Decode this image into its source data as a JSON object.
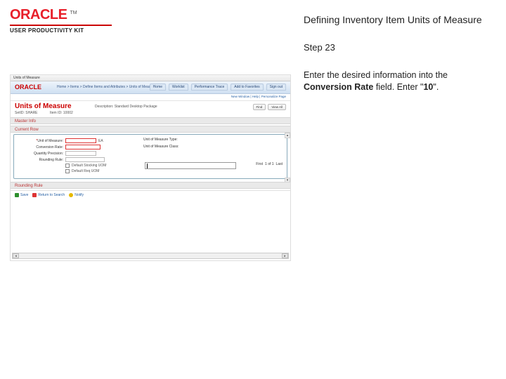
{
  "brand": {
    "oracle_word": "ORACLE",
    "tm": "TM",
    "upk_label": "USER PRODUCTIVITY KIT"
  },
  "topic_title": "Defining Inventory Item Units of Measure",
  "step_label": "Step 23",
  "instruction": {
    "pre": "Enter the desired information into the ",
    "bold1": "Conversion Rate",
    "mid": " field. Enter \"",
    "bold2": "10",
    "post": "\"."
  },
  "mini": {
    "titlebar": "Units of Measure",
    "crumbs": "Home > Items > Define Items and Attributes > Units of Measure",
    "tabs": [
      "Home",
      "Worklist",
      "Performance Trace",
      "Add to Favorites",
      "Sign out"
    ],
    "sublinks": "New Window | Help | Personalize Page",
    "page_h1": "Units of Measure",
    "meta_setid": "SetID: SHARE",
    "meta_itemid": "Item ID: 10002",
    "meta_desc": "Description: Standard Desktop Package",
    "actions": [
      "Find",
      "View All"
    ],
    "section_master": "Master Info",
    "section_current": "Current Row",
    "fields": {
      "uom": {
        "label": "Unit of Measure:",
        "req": true,
        "value": "EA"
      },
      "qty": {
        "label": "Quantity Precision:",
        "value": ""
      },
      "convrate_left": {
        "label": "Conversion Rate:"
      },
      "rounding": {
        "label": "Rounding Rule:"
      },
      "default_stocking": "Default Stocking UOM",
      "default_req": "Default Req UOM"
    },
    "right_labels": {
      "uom_type": "Unit of Measure Type:",
      "uom_class": "Unit of Measure Class:"
    },
    "rate_nav": {
      "first": "First",
      "count": "1 of 1",
      "last": "Last"
    },
    "section_rounding": "Rounding Rule",
    "bottom": {
      "save": "Save",
      "return": "Return to Search",
      "notify": "Notify"
    }
  }
}
